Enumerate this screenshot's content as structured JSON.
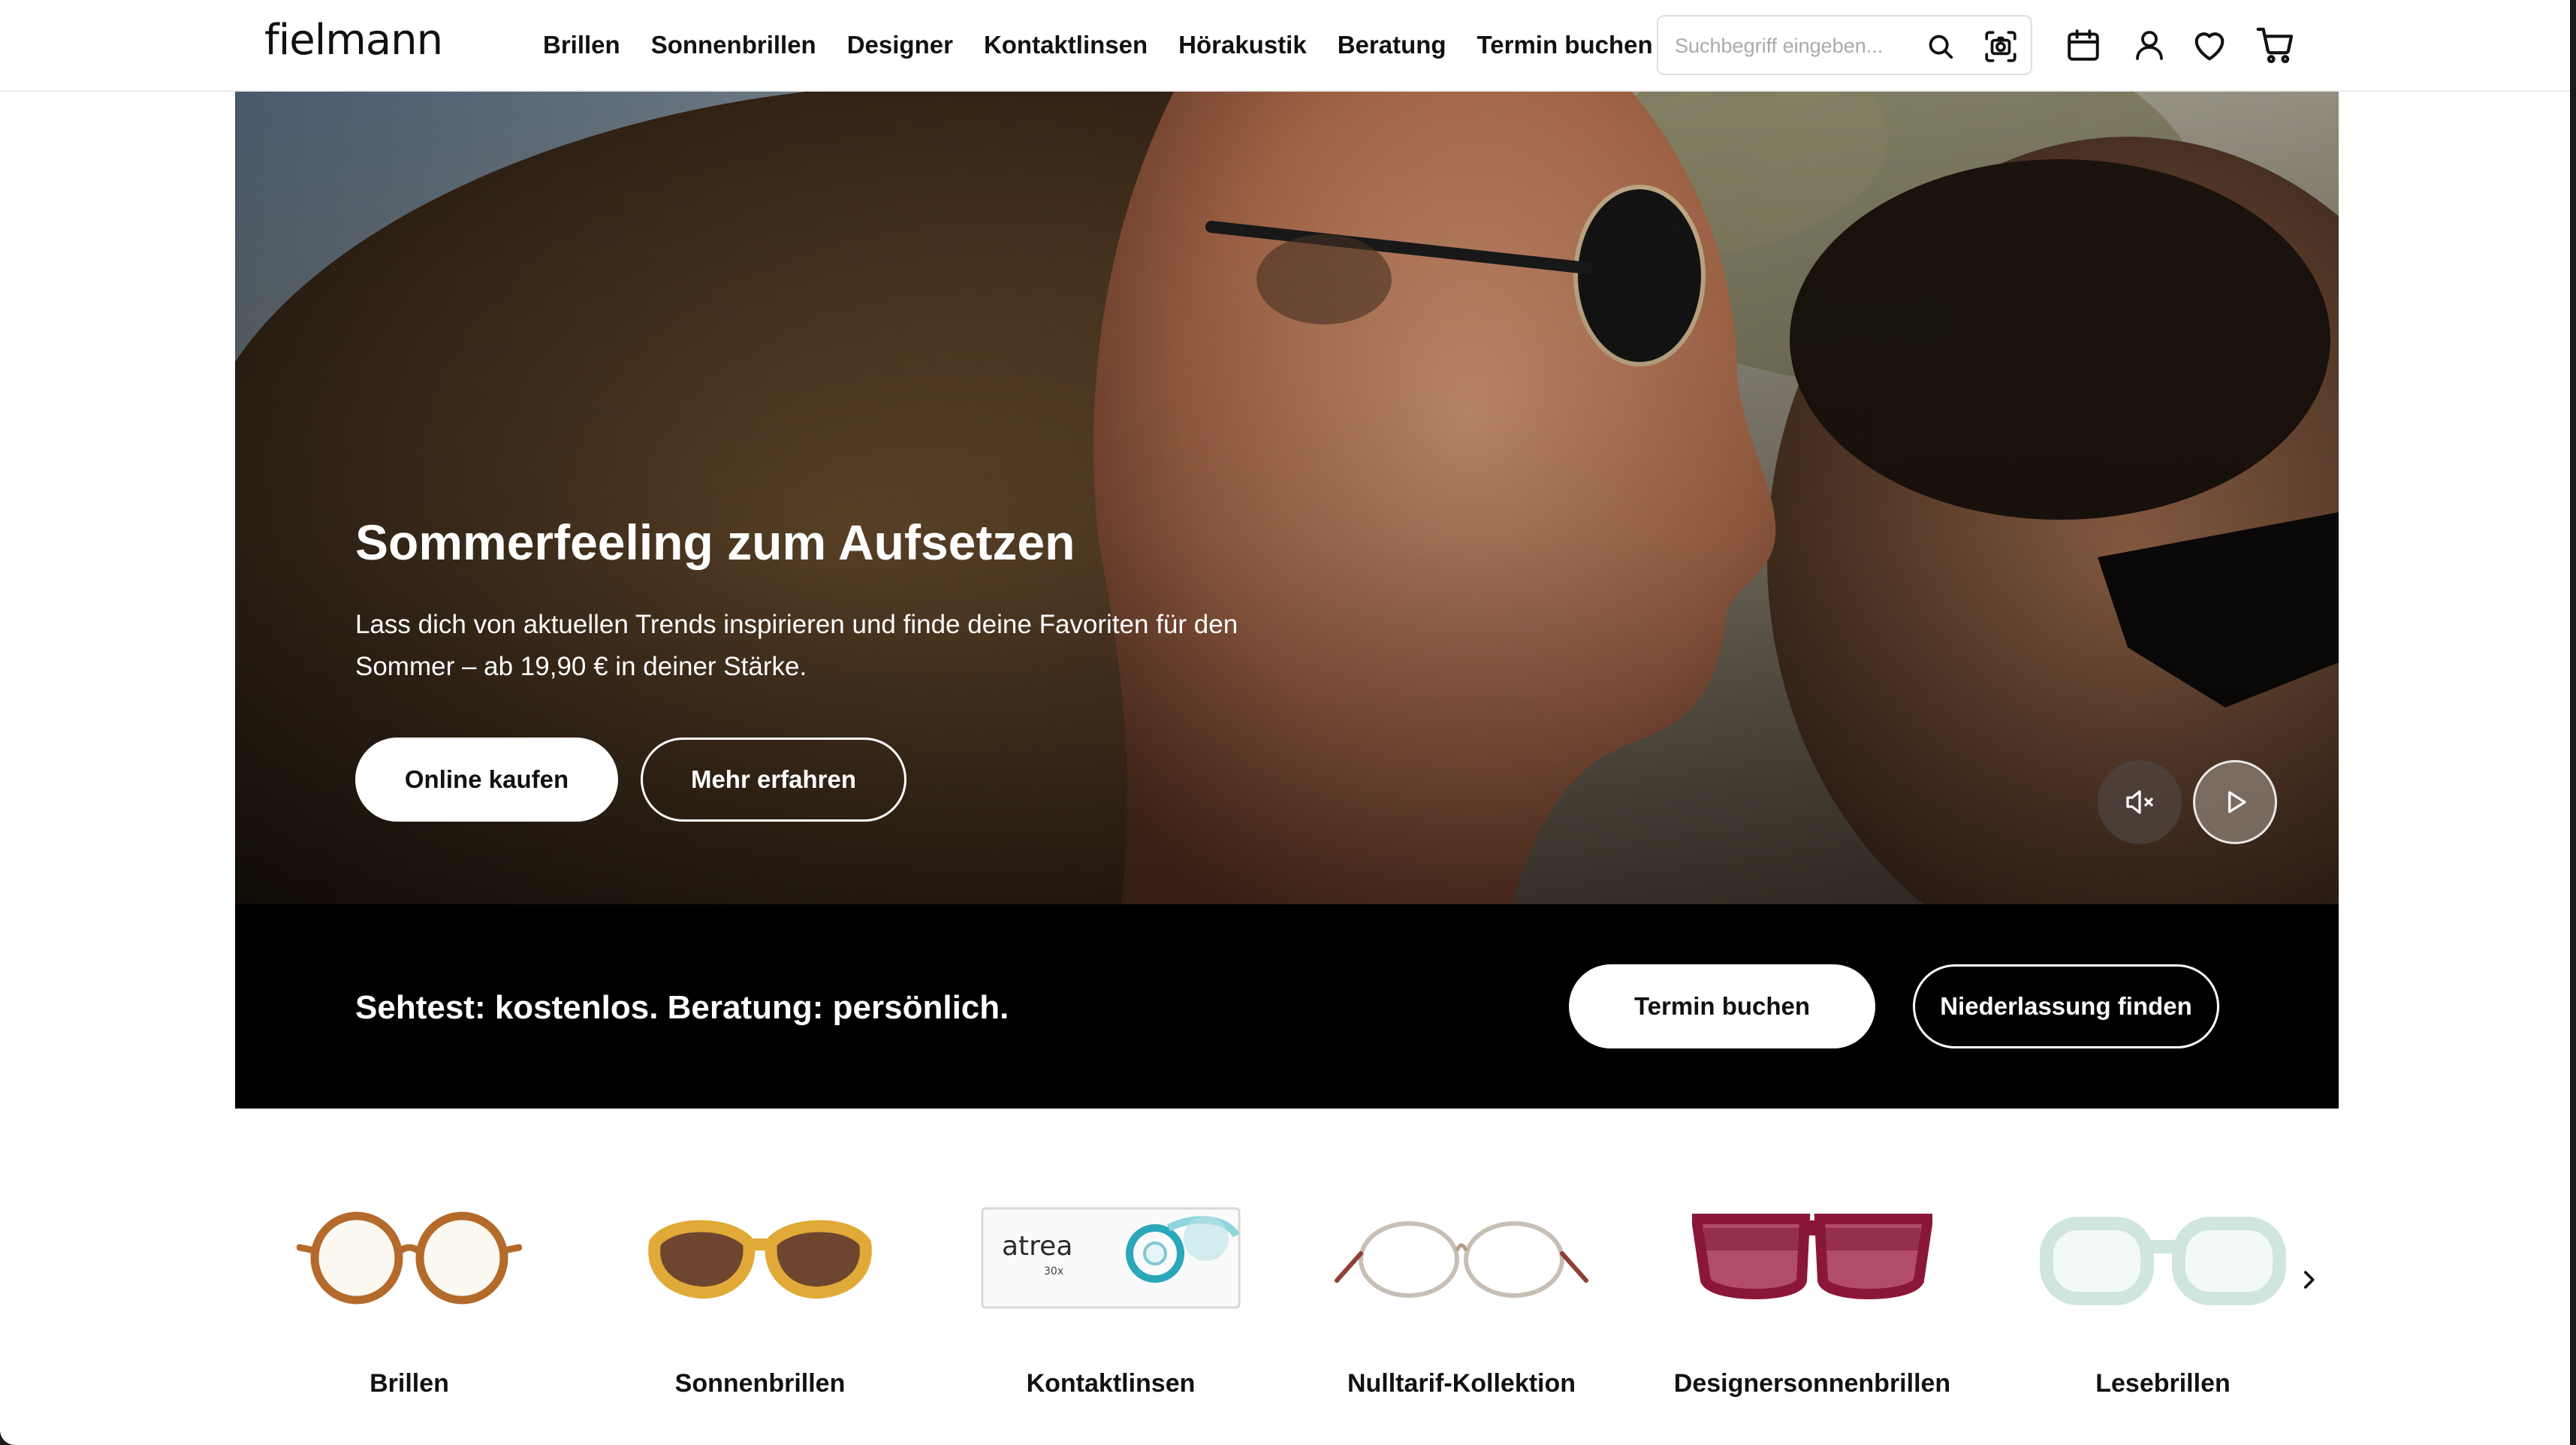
{
  "brand": {
    "logo_text": "fielmann"
  },
  "nav": {
    "items": [
      "Brillen",
      "Sonnenbrillen",
      "Designer",
      "Kontaktlinsen",
      "Hörakustik",
      "Beratung",
      "Termin buchen"
    ]
  },
  "search": {
    "placeholder": "Suchbegriff eingeben...",
    "value": ""
  },
  "header_icons": [
    "search-icon",
    "camera-search-icon",
    "calendar-icon",
    "account-icon",
    "wishlist-heart-icon",
    "cart-icon"
  ],
  "hero": {
    "title": "Sommerfeeling zum Aufsetzen",
    "description": "Lass dich von aktuellen Trends inspirieren und finde deine Favoriten für den Sommer – ab 19,90 € in deiner Stärke.",
    "primary_button": "Online kaufen",
    "secondary_button": "Mehr erfahren",
    "controls": [
      "mute-icon",
      "play-icon"
    ]
  },
  "banner": {
    "text": "Sehtest: kostenlos. Beratung: persönlich.",
    "primary_button": "Termin buchen",
    "secondary_button": "Niederlassung finden"
  },
  "categories": [
    {
      "label": "Brillen",
      "icon": "round-glasses"
    },
    {
      "label": "Sonnenbrillen",
      "icon": "cat-eye-sunglasses"
    },
    {
      "label": "Kontaktlinsen",
      "icon": "contact-lens-box",
      "box_brand": "atrea",
      "box_count": "30x"
    },
    {
      "label": "Nulltarif-Kollektion",
      "icon": "metal-frame-glasses"
    },
    {
      "label": "Designersonnenbrillen",
      "icon": "designer-sunglasses"
    },
    {
      "label": "Lesebrillen",
      "icon": "reading-glasses"
    }
  ],
  "colors": {
    "text": "#111111",
    "banner_bg": "#000000",
    "button_bg": "#ffffff"
  }
}
